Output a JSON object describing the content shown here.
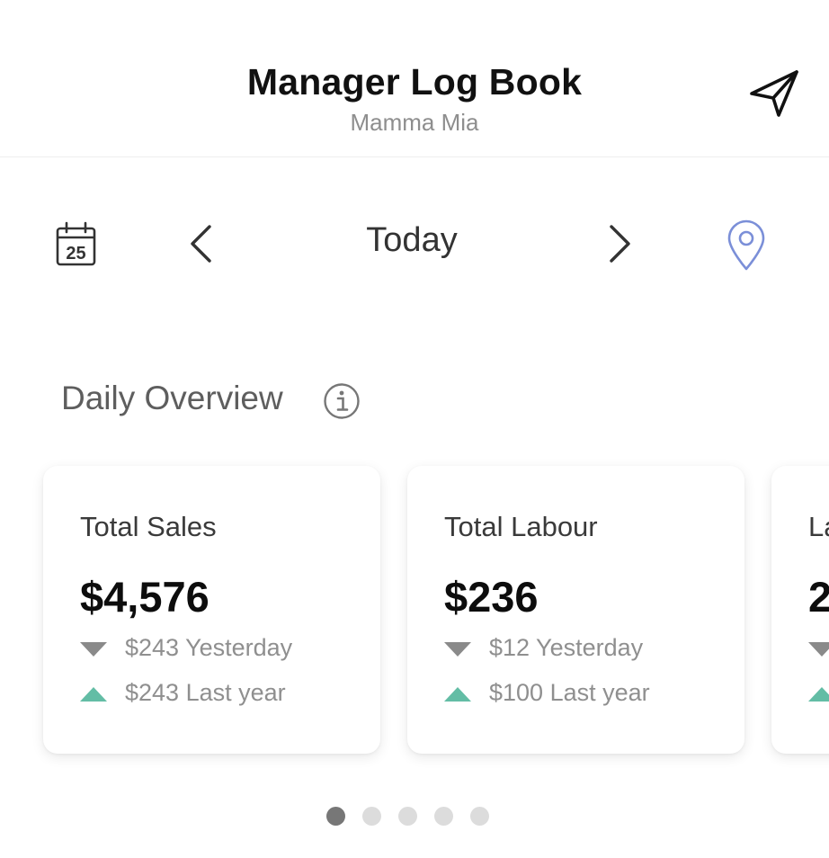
{
  "header": {
    "title": "Manager Log Book",
    "subtitle": "Mamma Mia",
    "send_icon": "paper-plane-icon"
  },
  "date_nav": {
    "calendar_icon": "calendar-icon",
    "calendar_day": "25",
    "current_label": "Today",
    "prev_icon": "chevron-left-icon",
    "next_icon": "chevron-right-icon",
    "location_icon": "map-pin-icon",
    "location_color": "#7b8fd8"
  },
  "overview": {
    "title": "Daily Overview",
    "info_icon": "info-icon"
  },
  "colors": {
    "down": "#8a8a8a",
    "up": "#63bda5"
  },
  "cards": [
    {
      "title": "Total Sales",
      "value": "$4,576",
      "comparisons": [
        {
          "direction": "down",
          "text": "$243 Yesterday"
        },
        {
          "direction": "up",
          "text": "$243 Last year"
        }
      ]
    },
    {
      "title": "Total Labour",
      "value": "$236",
      "comparisons": [
        {
          "direction": "down",
          "text": "$12 Yesterday"
        },
        {
          "direction": "up",
          "text": "$100 Last year"
        }
      ]
    },
    {
      "title": "La",
      "value": "2",
      "comparisons": [
        {
          "direction": "down",
          "text": ""
        },
        {
          "direction": "up",
          "text": ""
        }
      ]
    }
  ],
  "pager": {
    "count": 5,
    "active_index": 0
  }
}
